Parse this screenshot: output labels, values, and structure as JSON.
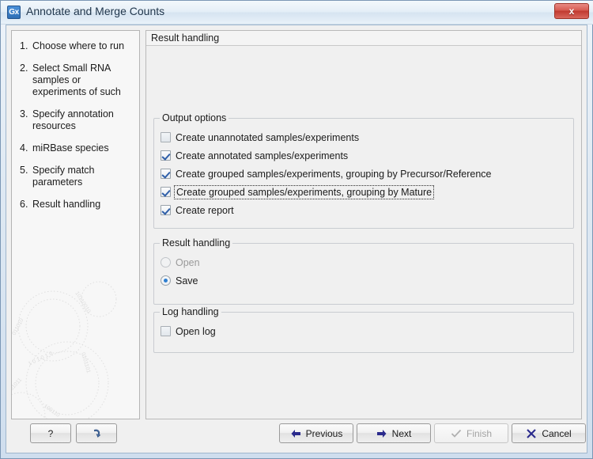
{
  "window": {
    "title": "Annotate and Merge Counts",
    "app_icon_label": "Gx",
    "close_label": "x"
  },
  "sidebar": {
    "steps": [
      {
        "num": "1.",
        "label": "Choose where to run"
      },
      {
        "num": "2.",
        "label": "Select Small RNA samples or experiments of such"
      },
      {
        "num": "3.",
        "label": "Specify annotation resources"
      },
      {
        "num": "4.",
        "label": "miRBase species"
      },
      {
        "num": "5.",
        "label": "Specify match parameters"
      },
      {
        "num": "6.",
        "label": "Result handling"
      }
    ]
  },
  "content": {
    "header": "Result handling",
    "output_options": {
      "title": "Output options",
      "items": [
        {
          "label": "Create unannotated samples/experiments",
          "checked": false,
          "focused": false
        },
        {
          "label": "Create annotated samples/experiments",
          "checked": true,
          "focused": false
        },
        {
          "label": "Create grouped samples/experiments, grouping by Precursor/Reference",
          "checked": true,
          "focused": false
        },
        {
          "label": "Create grouped samples/experiments, grouping by Mature",
          "checked": true,
          "focused": true
        },
        {
          "label": "Create report",
          "checked": true,
          "focused": false
        }
      ]
    },
    "result_handling": {
      "title": "Result handling",
      "options": [
        {
          "label": "Open",
          "selected": false,
          "disabled": true
        },
        {
          "label": "Save",
          "selected": true,
          "disabled": false
        }
      ]
    },
    "log_handling": {
      "title": "Log handling",
      "items": [
        {
          "label": "Open log",
          "checked": false
        }
      ]
    }
  },
  "buttons": {
    "help": "?",
    "undo": "",
    "previous": "Previous",
    "next": "Next",
    "finish": "Finish",
    "cancel": "Cancel"
  },
  "colors": {
    "accent_blue": "#2f5fa8",
    "radio_blue": "#2f7fd0",
    "close_red": "#c0392f",
    "nav_arrow": "#2a2a8c"
  }
}
